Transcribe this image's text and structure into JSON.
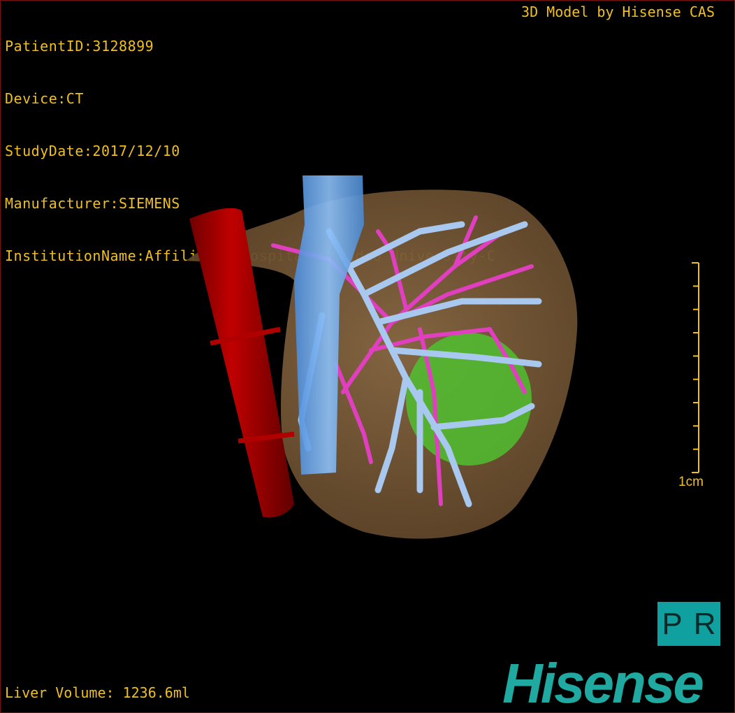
{
  "info": {
    "patient_id": "PatientID:3128899",
    "device": "Device:CT",
    "study_date": "StudyDate:2017/12/10",
    "manufacturer": "Manufacturer:SIEMENS",
    "institution": "InstitutionName:Affiliated Hospital Qingdao University-C"
  },
  "credit": "3D Model by Hisense CAS",
  "volume": "Liver Volume: 1236.6ml",
  "scale_bar": {
    "label": "1cm",
    "ticks": 10
  },
  "orientation": {
    "left": "P",
    "right": "R"
  },
  "logo": "Hisense",
  "colors": {
    "text": "#f0c020",
    "liver": "#7a5a3a",
    "portal_vein": "#a8c8f0",
    "hepatic_vein": "#e040c0",
    "ivc": "#5aa0e8",
    "aorta": "#b00000",
    "tumor": "#50c030",
    "logo": "#1fa9a0"
  }
}
